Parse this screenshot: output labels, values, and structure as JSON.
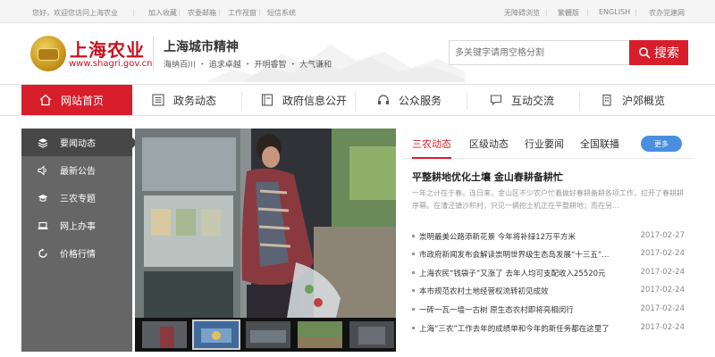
{
  "topbar": {
    "welcome": "您好，欢迎您访问上海农业",
    "links": [
      "加入收藏",
      "农委邮箱",
      "工作视窗",
      "短信系统"
    ],
    "accessibility": "无障碍浏览",
    "traditional": "繁體版",
    "english": "ENGLISH",
    "party": "农办党建网"
  },
  "header": {
    "logo_title": "上海农业",
    "logo_url": "www.shagri.gov.cn",
    "spirit_title": "上海城市精神",
    "spirit_sub": "海纳百川 ・ 追求卓越 ・ 开明睿智 ・ 大气谦和",
    "search_placeholder": "多关键字请用空格分割",
    "search_label": "搜索"
  },
  "nav": {
    "items": [
      {
        "label": "网站首页",
        "icon": "home-icon"
      },
      {
        "label": "政务动态",
        "icon": "list-icon"
      },
      {
        "label": "政府信息公开",
        "icon": "book-icon"
      },
      {
        "label": "公众服务",
        "icon": "headset-icon"
      },
      {
        "label": "互动交流",
        "icon": "chat-icon"
      },
      {
        "label": "沪郊概览",
        "icon": "building-icon"
      }
    ]
  },
  "sidebar": {
    "items": [
      {
        "label": "要闻动态",
        "icon": "layers-icon"
      },
      {
        "label": "最新公告",
        "icon": "speaker-icon"
      },
      {
        "label": "三农专题",
        "icon": "graduation-cap-icon"
      },
      {
        "label": "网上办事",
        "icon": "laptop-icon"
      },
      {
        "label": "价格行情",
        "icon": "refresh-icon"
      }
    ]
  },
  "news": {
    "tabs": [
      "三农动态",
      "区级动态",
      "行业要闻",
      "全国联播"
    ],
    "more": "更多",
    "headline": "平整耕地优化土壤 金山春耕备耕忙",
    "summary": "一年之计在于春。连日来，金山区不少农户忙着做好春耕备耕各项工作，拉开了春耕耕序幕。在漕泾镇沙积村，只见一辆挖土机正在平整耕地；而在另...",
    "items": [
      {
        "title": "崇明最美公路添新花景 今年将补绿12万平方米",
        "date": "2017-02-27"
      },
      {
        "title": "市政府新闻发布会解读崇明世界级生态岛发展“十三五”...",
        "date": "2017-02-24"
      },
      {
        "title": "上海农民“钱袋子”又涨了 去年人均可支配收入25520元",
        "date": "2017-02-24"
      },
      {
        "title": "本市规范农村土地经营权流转初见成效",
        "date": "2017-02-24"
      },
      {
        "title": "一砖一瓦一墙一古树 原生态农村即将亮相闵行",
        "date": "2017-02-24"
      },
      {
        "title": "上海“三农”工作去年的成绩单和今年的新任务都在这里了",
        "date": "2017-02-24"
      }
    ]
  },
  "colors": {
    "accent": "#d81e2b",
    "sidebar": "#666666",
    "sidebar_active": "#474747",
    "more": "#4a8ee0"
  }
}
